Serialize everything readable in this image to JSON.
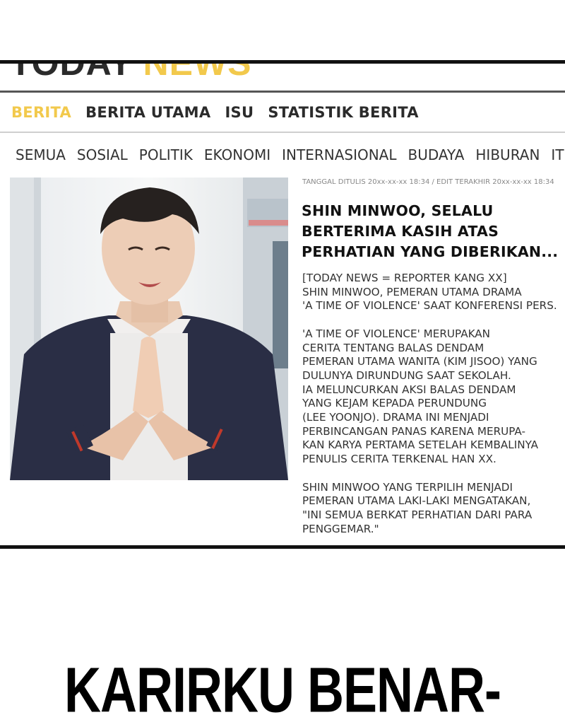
{
  "masthead": {
    "logo_part1": "TODAY ",
    "logo_part2": "NEWS"
  },
  "main_nav": [
    {
      "label": "BERITA",
      "active": true
    },
    {
      "label": "BERITA UTAMA",
      "active": false
    },
    {
      "label": "ISU",
      "active": false
    },
    {
      "label": "STATISTIK BERITA",
      "active": false
    }
  ],
  "sub_nav": [
    "SEMUA",
    "SOSIAL",
    "POLITIK",
    "EKONOMI",
    "INTERNASIONAL",
    "BUDAYA",
    "HIBURAN",
    "IT"
  ],
  "article": {
    "meta": "TANGGAL DITULIS 20xx-xx-xx 18:34 / EDIT TERAKHIR 20xx-xx-xx 18:34",
    "headline_lines": [
      "SHIN MINWOO, SELALU",
      "BERTERIMA KASIH ATAS",
      "PERHATIAN YANG DIBERIKAN..."
    ],
    "paragraph1": [
      "[TODAY NEWS = REPORTER KANG XX]",
      "SHIN MINWOO, PEMERAN UTAMA DRAMA",
      "'A TIME OF VIOLENCE' SAAT KONFERENSI PERS."
    ],
    "paragraph2": [
      "'A TIME OF VIOLENCE' MERUPAKAN",
      "CERITA TENTANG BALAS DENDAM",
      "PEMERAN UTAMA WANITA (KIM JISOO) YANG",
      "DULUNYA DIRUNDUNG SAAT SEKOLAH.",
      "IA MELUNCURKAN AKSI BALAS DENDAM",
      "YANG KEJAM KEPADA PERUNDUNG",
      "(LEE YOONJO). DRAMA INI MENJADI",
      "PERBINCANGAN PANAS KARENA MERUPA-",
      "KAN KARYA PERTAMA SETELAH KEMBALINYA",
      "PENULIS CERITA TERKENAL HAN XX."
    ],
    "paragraph3": [
      "SHIN MINWOO YANG TERPILIH MENJADI",
      "PEMERAN UTAMA LAKI-LAKI MENGATAKAN,",
      "\"INI SEMUA BERKAT PERHATIAN DARI PARA",
      "PENGGEMAR.\""
    ]
  },
  "caption": "KARIRKU BENAR-",
  "colors": {
    "accent": "#f2c94c",
    "ink": "#2b2b2b",
    "frame": "#111111"
  }
}
